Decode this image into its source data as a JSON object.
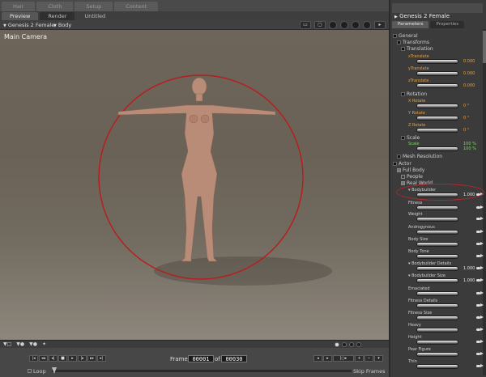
{
  "top_tabs": [
    "Hair",
    "Cloth",
    "Setup",
    "Content"
  ],
  "view_tabs": [
    {
      "label": "Preview",
      "active": true
    },
    {
      "label": "Render",
      "active": false
    },
    {
      "label": "Untitled",
      "active": false
    }
  ],
  "toolbar": {
    "figure_dropdown": "Genesis 2 Female",
    "node_dropdown": "Body"
  },
  "viewport": {
    "camera_label": "Main Camera",
    "colors": {
      "background": "#6d6559",
      "selection_ring": "#b81e1e",
      "skin": "#b98c78"
    }
  },
  "timeline": {
    "frame_label": "Frame",
    "current_frame": "00001",
    "of_label": "of",
    "total_frames": "00030",
    "loop_label": "Loop",
    "skip_frames_label": "Skip Frames"
  },
  "panel": {
    "title": "Genesis 2 Female",
    "tabs": [
      {
        "label": "Parameters",
        "active": true
      },
      {
        "label": "Properties",
        "active": false
      }
    ],
    "tree": {
      "general": "General",
      "transforms": "Transforms",
      "translation": "Translation",
      "rotation": "Rotation",
      "scale": "Scale",
      "mesh_resolution": "Mesh Resolution",
      "actor": "Actor",
      "full_body": "Full Body",
      "people": "People",
      "real_world": "Real World"
    },
    "translation_params": [
      {
        "label": "xTranslate",
        "value": "0.000"
      },
      {
        "label": "yTranslate",
        "value": "0.000"
      },
      {
        "label": "zTranslate",
        "value": "0.000"
      }
    ],
    "rotation_params": [
      {
        "label": "X Rotate",
        "value": "0 °"
      },
      {
        "label": "Y Rotate",
        "value": "0 °"
      },
      {
        "label": "Z Rotate",
        "value": "0 °"
      }
    ],
    "scale_param": {
      "label": "Scale",
      "value": "100 %",
      "value2": "100 %"
    },
    "morphs": [
      {
        "label": "Bodybuilder",
        "value": "1.000",
        "highlight": true
      },
      {
        "label": "Fitness",
        "value": ""
      },
      {
        "label": "Weight",
        "value": ""
      },
      {
        "label": "Androgynous",
        "value": ""
      },
      {
        "label": "Body Size",
        "value": ""
      },
      {
        "label": "Body Tone",
        "value": ""
      },
      {
        "label": "Bodybuilder Details",
        "value": "1.000"
      },
      {
        "label": "Bodybuilder Size",
        "value": "1.000"
      },
      {
        "label": "Emaciated",
        "value": ""
      },
      {
        "label": "Fitness Details",
        "value": ""
      },
      {
        "label": "Fitness Size",
        "value": ""
      },
      {
        "label": "Heavy",
        "value": ""
      },
      {
        "label": "Height",
        "value": ""
      },
      {
        "label": "Pear Figure",
        "value": ""
      },
      {
        "label": "Thin",
        "value": ""
      }
    ]
  }
}
